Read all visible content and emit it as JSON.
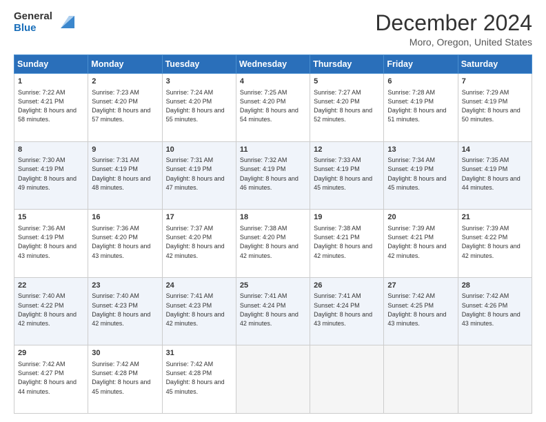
{
  "header": {
    "logo_general": "General",
    "logo_blue": "Blue",
    "month_title": "December 2024",
    "location": "Moro, Oregon, United States"
  },
  "days_of_week": [
    "Sunday",
    "Monday",
    "Tuesday",
    "Wednesday",
    "Thursday",
    "Friday",
    "Saturday"
  ],
  "weeks": [
    [
      {
        "day": "1",
        "sunrise": "7:22 AM",
        "sunset": "4:21 PM",
        "daylight": "8 hours and 58 minutes."
      },
      {
        "day": "2",
        "sunrise": "7:23 AM",
        "sunset": "4:20 PM",
        "daylight": "8 hours and 57 minutes."
      },
      {
        "day": "3",
        "sunrise": "7:24 AM",
        "sunset": "4:20 PM",
        "daylight": "8 hours and 55 minutes."
      },
      {
        "day": "4",
        "sunrise": "7:25 AM",
        "sunset": "4:20 PM",
        "daylight": "8 hours and 54 minutes."
      },
      {
        "day": "5",
        "sunrise": "7:27 AM",
        "sunset": "4:20 PM",
        "daylight": "8 hours and 52 minutes."
      },
      {
        "day": "6",
        "sunrise": "7:28 AM",
        "sunset": "4:19 PM",
        "daylight": "8 hours and 51 minutes."
      },
      {
        "day": "7",
        "sunrise": "7:29 AM",
        "sunset": "4:19 PM",
        "daylight": "8 hours and 50 minutes."
      }
    ],
    [
      {
        "day": "8",
        "sunrise": "7:30 AM",
        "sunset": "4:19 PM",
        "daylight": "8 hours and 49 minutes."
      },
      {
        "day": "9",
        "sunrise": "7:31 AM",
        "sunset": "4:19 PM",
        "daylight": "8 hours and 48 minutes."
      },
      {
        "day": "10",
        "sunrise": "7:31 AM",
        "sunset": "4:19 PM",
        "daylight": "8 hours and 47 minutes."
      },
      {
        "day": "11",
        "sunrise": "7:32 AM",
        "sunset": "4:19 PM",
        "daylight": "8 hours and 46 minutes."
      },
      {
        "day": "12",
        "sunrise": "7:33 AM",
        "sunset": "4:19 PM",
        "daylight": "8 hours and 45 minutes."
      },
      {
        "day": "13",
        "sunrise": "7:34 AM",
        "sunset": "4:19 PM",
        "daylight": "8 hours and 45 minutes."
      },
      {
        "day": "14",
        "sunrise": "7:35 AM",
        "sunset": "4:19 PM",
        "daylight": "8 hours and 44 minutes."
      }
    ],
    [
      {
        "day": "15",
        "sunrise": "7:36 AM",
        "sunset": "4:19 PM",
        "daylight": "8 hours and 43 minutes."
      },
      {
        "day": "16",
        "sunrise": "7:36 AM",
        "sunset": "4:20 PM",
        "daylight": "8 hours and 43 minutes."
      },
      {
        "day": "17",
        "sunrise": "7:37 AM",
        "sunset": "4:20 PM",
        "daylight": "8 hours and 42 minutes."
      },
      {
        "day": "18",
        "sunrise": "7:38 AM",
        "sunset": "4:20 PM",
        "daylight": "8 hours and 42 minutes."
      },
      {
        "day": "19",
        "sunrise": "7:38 AM",
        "sunset": "4:21 PM",
        "daylight": "8 hours and 42 minutes."
      },
      {
        "day": "20",
        "sunrise": "7:39 AM",
        "sunset": "4:21 PM",
        "daylight": "8 hours and 42 minutes."
      },
      {
        "day": "21",
        "sunrise": "7:39 AM",
        "sunset": "4:22 PM",
        "daylight": "8 hours and 42 minutes."
      }
    ],
    [
      {
        "day": "22",
        "sunrise": "7:40 AM",
        "sunset": "4:22 PM",
        "daylight": "8 hours and 42 minutes."
      },
      {
        "day": "23",
        "sunrise": "7:40 AM",
        "sunset": "4:23 PM",
        "daylight": "8 hours and 42 minutes."
      },
      {
        "day": "24",
        "sunrise": "7:41 AM",
        "sunset": "4:23 PM",
        "daylight": "8 hours and 42 minutes."
      },
      {
        "day": "25",
        "sunrise": "7:41 AM",
        "sunset": "4:24 PM",
        "daylight": "8 hours and 42 minutes."
      },
      {
        "day": "26",
        "sunrise": "7:41 AM",
        "sunset": "4:24 PM",
        "daylight": "8 hours and 43 minutes."
      },
      {
        "day": "27",
        "sunrise": "7:42 AM",
        "sunset": "4:25 PM",
        "daylight": "8 hours and 43 minutes."
      },
      {
        "day": "28",
        "sunrise": "7:42 AM",
        "sunset": "4:26 PM",
        "daylight": "8 hours and 43 minutes."
      }
    ],
    [
      {
        "day": "29",
        "sunrise": "7:42 AM",
        "sunset": "4:27 PM",
        "daylight": "8 hours and 44 minutes."
      },
      {
        "day": "30",
        "sunrise": "7:42 AM",
        "sunset": "4:28 PM",
        "daylight": "8 hours and 45 minutes."
      },
      {
        "day": "31",
        "sunrise": "7:42 AM",
        "sunset": "4:28 PM",
        "daylight": "8 hours and 45 minutes."
      },
      null,
      null,
      null,
      null
    ]
  ]
}
